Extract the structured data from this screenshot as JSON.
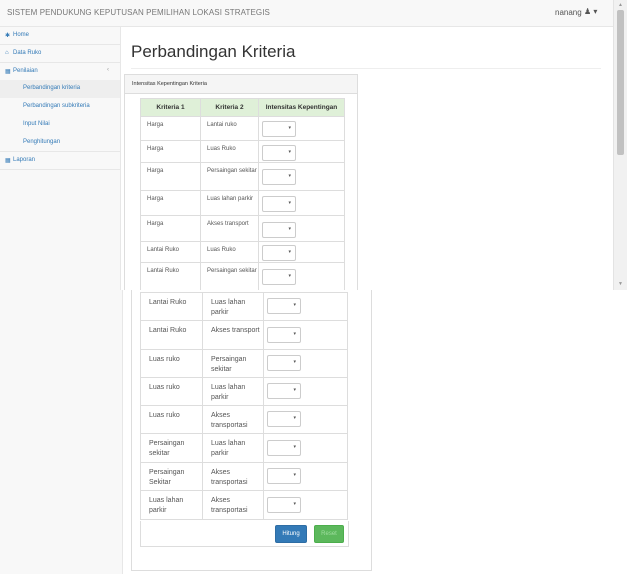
{
  "navbar": {
    "brand": "SISTEM PENDUKUNG KEPUTUSAN PEMILIHAN LOKASI STRATEGIS",
    "user": "nanang",
    "user_icon": "♟ ▾"
  },
  "sidebar": {
    "items": [
      {
        "label": "Home",
        "icon": "home-icon",
        "glyph": "✱"
      },
      {
        "label": "Data Ruko",
        "icon": "building-icon",
        "glyph": "⌂"
      },
      {
        "label": "Penilaian",
        "icon": "table-icon",
        "glyph": "▦",
        "chevron": "‹"
      },
      {
        "label": "Laporan",
        "icon": "table-icon",
        "glyph": "▦"
      }
    ],
    "subitems": [
      {
        "label": "Perbandingan kriteria",
        "active": true
      },
      {
        "label": "Perbandingan subkriteria",
        "active": false
      },
      {
        "label": "Input Nilai",
        "active": false
      },
      {
        "label": "Penghitungan",
        "active": false
      }
    ]
  },
  "main": {
    "page_title": "Perbandingan Kriteria",
    "panel_title": "Intensitas Kepentingan Kriteria",
    "columns": [
      "Kriteria 1",
      "Kriteria 2",
      "Intensitas Kepentingan"
    ],
    "rows_top": [
      {
        "k1": "Harga",
        "k2": "Lantai ruko"
      },
      {
        "k1": "Harga",
        "k2": "Luas Ruko"
      },
      {
        "k1": "Harga",
        "k2": "Persaingan sekitar"
      },
      {
        "k1": "Harga",
        "k2": "Luas lahan parkir"
      },
      {
        "k1": "Harga",
        "k2": "Akses transport"
      },
      {
        "k1": "Lantai Ruko",
        "k2": "Luas Ruko"
      },
      {
        "k1": "Lantai Ruko",
        "k2": "Persaingan sekitar"
      }
    ],
    "rows_bottom": [
      {
        "k1": "Lantai Ruko",
        "k2": "Luas lahan parkir"
      },
      {
        "k1": "Lantai Ruko",
        "k2": "Akses transport"
      },
      {
        "k1": "Luas ruko",
        "k2": "Persaingan sekitar"
      },
      {
        "k1": "Luas ruko",
        "k2": "Luas lahan parkir"
      },
      {
        "k1": "Luas ruko",
        "k2": "Akses transportasi"
      },
      {
        "k1": "Persaingan sekitar",
        "k2": "Luas lahan parkir"
      },
      {
        "k1": "Persaingan Sekitar",
        "k2": "Akses transportasi"
      },
      {
        "k1": "Luas lahan parkir",
        "k2": "Akses transportasi"
      }
    ],
    "select_caret": "▾",
    "hitung_label": "Hitung",
    "reset_label": "Reset"
  },
  "scroll": {
    "up": "▲",
    "down": "▼"
  },
  "colors": {
    "link": "#337ab7",
    "header_green": "#dff0d8",
    "btn_primary": "#337ab7",
    "btn_success": "#5cb85c"
  }
}
